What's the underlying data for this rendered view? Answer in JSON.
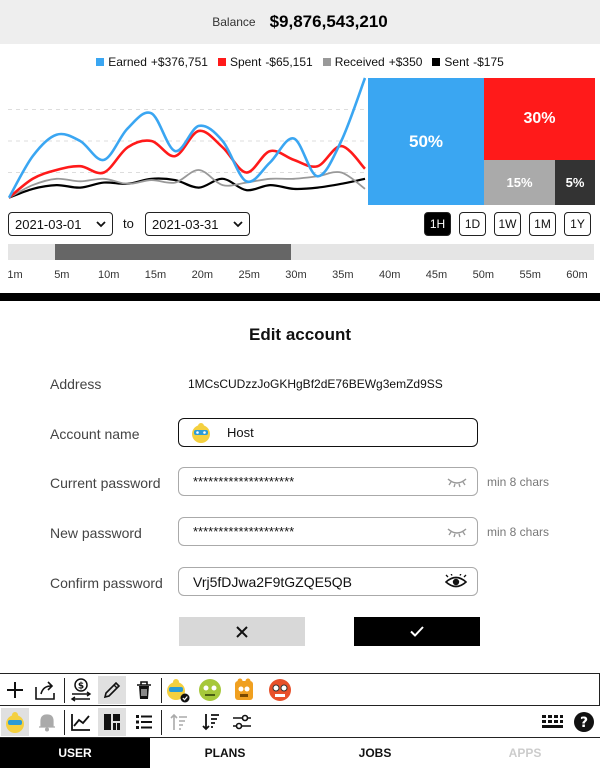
{
  "balance": {
    "label": "Balance",
    "value": "$9,876,543,210"
  },
  "legend": [
    {
      "name": "Earned",
      "value": "+$376,751",
      "color": "#3aa6f2"
    },
    {
      "name": "Spent",
      "value": "-$65,151",
      "color": "#ff1a1a"
    },
    {
      "name": "Received",
      "value": "+$350",
      "color": "#999999"
    },
    {
      "name": "Sent",
      "value": "-$175",
      "color": "#000000"
    }
  ],
  "chart_data": [
    {
      "type": "line",
      "x": [
        0,
        1,
        2,
        3,
        4,
        5,
        6,
        7,
        8,
        9,
        10,
        11,
        12,
        13,
        14,
        15
      ],
      "series": [
        {
          "name": "Earned",
          "color": "#3aa6f2",
          "values": [
            0.05,
            0.38,
            0.55,
            0.5,
            0.35,
            0.6,
            0.72,
            0.42,
            0.62,
            0.5,
            0.18,
            0.33,
            0.52,
            0.22,
            0.5,
            1.0
          ]
        },
        {
          "name": "Spent",
          "color": "#ff1a1a",
          "values": [
            0.05,
            0.2,
            0.27,
            0.3,
            0.25,
            0.45,
            0.5,
            0.38,
            0.58,
            0.45,
            0.25,
            0.42,
            0.35,
            0.3,
            0.46,
            0.28
          ]
        },
        {
          "name": "Received",
          "color": "#999999",
          "values": [
            0.05,
            0.15,
            0.2,
            0.18,
            0.2,
            0.16,
            0.19,
            0.17,
            0.27,
            0.15,
            0.17,
            0.2,
            0.2,
            0.22,
            0.25,
            0.12
          ]
        },
        {
          "name": "Sent",
          "color": "#000000",
          "values": [
            0.05,
            0.12,
            0.15,
            0.13,
            0.17,
            0.16,
            0.2,
            0.19,
            0.13,
            0.2,
            0.11,
            0.15,
            0.12,
            0.13,
            0.16,
            0.2
          ]
        }
      ]
    },
    {
      "type": "treemap",
      "categories": [
        "Earned",
        "Spent",
        "Received",
        "Sent"
      ],
      "values": [
        50,
        30,
        15,
        5
      ],
      "labels": [
        "50%",
        "30%",
        "15%",
        "5%"
      ],
      "colors": [
        "#3aa6f2",
        "#ff1a1a",
        "#aaaaaa",
        "#333333"
      ]
    }
  ],
  "date_range": {
    "from": "2021-03-01",
    "to_label": "to",
    "to": "2021-03-31"
  },
  "ranges": [
    "1H",
    "1D",
    "1W",
    "1M",
    "1Y"
  ],
  "active_range": "1H",
  "timeline": {
    "ticks": [
      "1m",
      "5m",
      "10m",
      "15m",
      "20m",
      "25m",
      "30m",
      "35m",
      "40m",
      "45m",
      "50m",
      "55m",
      "60m"
    ],
    "selection_start": "5m",
    "selection_end": "30m"
  },
  "form": {
    "title": "Edit account",
    "address_label": "Address",
    "address_value": "1MCsCUDzzJoGKHgBf2dE76BEWg3emZd9SS",
    "name_label": "Account name",
    "name_value": "Host",
    "current_pw_label": "Current password",
    "current_pw_value": "********************",
    "current_pw_hint": "min 8 chars",
    "new_pw_label": "New password",
    "new_pw_value": "********************",
    "new_pw_hint": "min 8 chars",
    "confirm_pw_label": "Confirm password",
    "confirm_pw_value": "Vrj5fDJwa2F9tGZQE5QB"
  },
  "toolbar_top": [
    "add-icon",
    "export-icon",
    "transfer-icon",
    "edit-icon",
    "delete-icon",
    "avatar-selected-icon",
    "avatar-green-icon",
    "avatar-orange-icon",
    "avatar-red-icon"
  ],
  "toolbar_bottom": [
    "avatar-icon",
    "bell-icon",
    "chart-icon",
    "treemap-icon",
    "list-icon",
    "sort-asc-icon",
    "sort-desc-icon",
    "filter-icon",
    "keyboard-icon",
    "help-icon"
  ],
  "tabs": [
    {
      "label": "USER",
      "state": "active"
    },
    {
      "label": "PLANS",
      "state": "normal"
    },
    {
      "label": "JOBS",
      "state": "normal"
    },
    {
      "label": "APPS",
      "state": "disabled"
    }
  ]
}
